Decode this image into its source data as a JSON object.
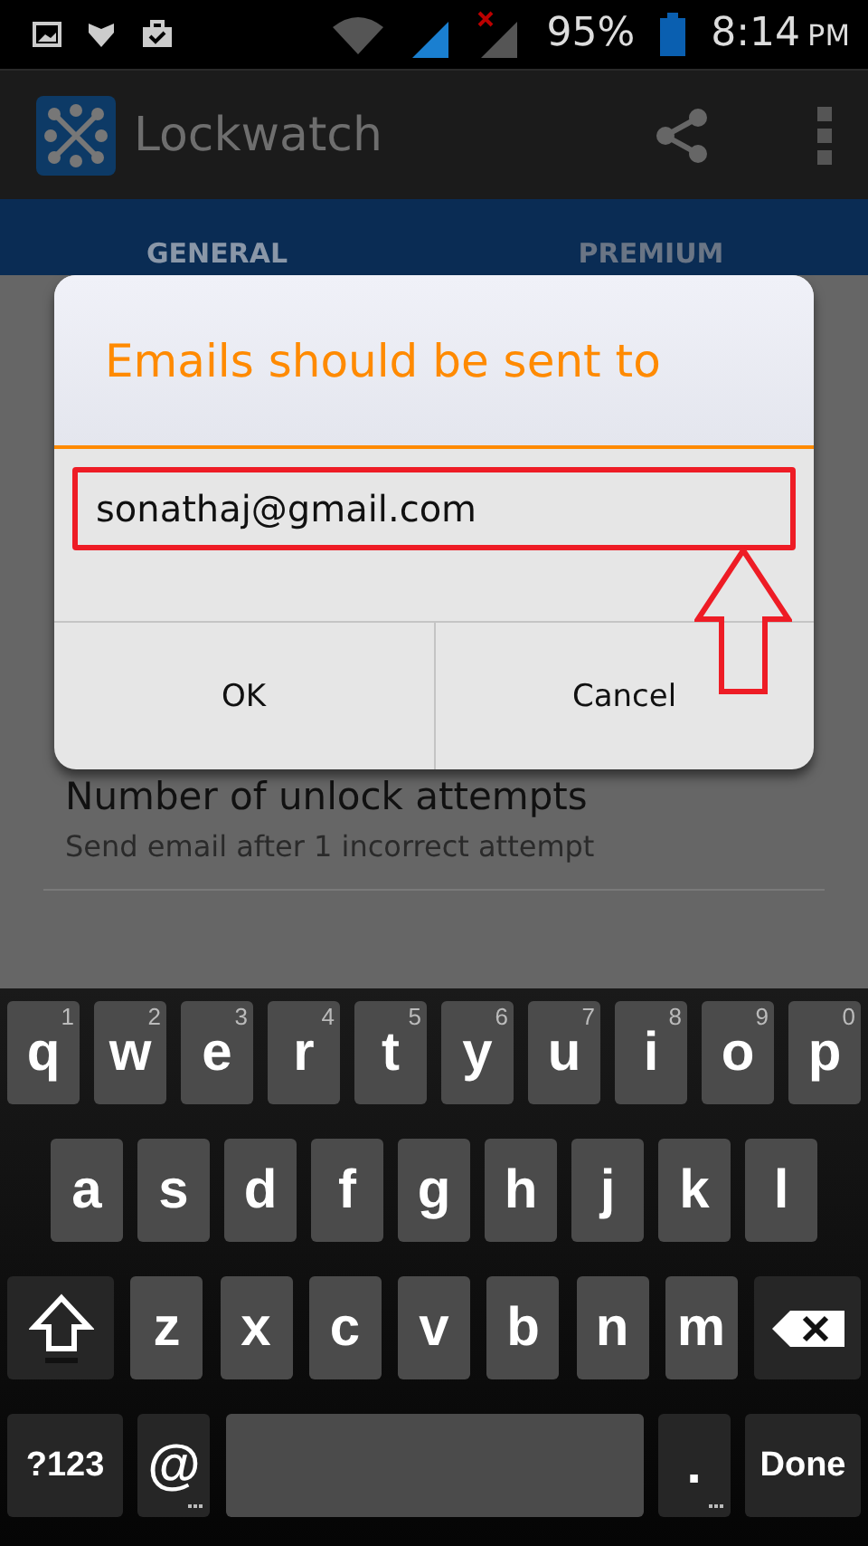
{
  "status_bar": {
    "battery": "95%",
    "time": "8:14",
    "ampm": "PM"
  },
  "app_bar": {
    "title": "Lockwatch"
  },
  "tabs": [
    {
      "label": "GENERAL",
      "selected": true
    },
    {
      "label": "PREMIUM",
      "selected": false
    }
  ],
  "settings": [
    {
      "title": "Number of unlock attempts",
      "summary": "Send email after 1 incorrect attempt"
    }
  ],
  "dialog": {
    "title": "Emails should be sent to",
    "field": {
      "value": "sonathaj@gmail.com"
    },
    "buttons": [
      "OK",
      "Cancel"
    ]
  },
  "keyboard": {
    "row_1": [
      {
        "kind": "letter",
        "label": "q",
        "hint": "1"
      },
      {
        "kind": "letter",
        "label": "w",
        "hint": "2"
      },
      {
        "kind": "letter",
        "label": "e",
        "hint": "3"
      },
      {
        "kind": "letter",
        "label": "r",
        "hint": "4"
      },
      {
        "kind": "letter",
        "label": "t",
        "hint": "5"
      },
      {
        "kind": "letter",
        "label": "y",
        "hint": "6"
      },
      {
        "kind": "letter",
        "label": "u",
        "hint": "7"
      },
      {
        "kind": "letter",
        "label": "i",
        "hint": "8"
      },
      {
        "kind": "letter",
        "label": "o",
        "hint": "9"
      },
      {
        "kind": "letter",
        "label": "p",
        "hint": "0"
      }
    ],
    "row_2": [
      {
        "kind": "letter",
        "label": "a"
      },
      {
        "kind": "letter",
        "label": "s"
      },
      {
        "kind": "letter",
        "label": "d"
      },
      {
        "kind": "letter",
        "label": "f"
      },
      {
        "kind": "letter",
        "label": "g"
      },
      {
        "kind": "letter",
        "label": "h"
      },
      {
        "kind": "letter",
        "label": "j"
      },
      {
        "kind": "letter",
        "label": "k"
      },
      {
        "kind": "letter",
        "label": "l"
      }
    ],
    "row_3": [
      {
        "kind": "shift"
      },
      {
        "kind": "letter",
        "label": "z"
      },
      {
        "kind": "letter",
        "label": "x"
      },
      {
        "kind": "letter",
        "label": "c"
      },
      {
        "kind": "letter",
        "label": "v"
      },
      {
        "kind": "letter",
        "label": "b"
      },
      {
        "kind": "letter",
        "label": "n"
      },
      {
        "kind": "letter",
        "label": "m"
      },
      {
        "kind": "backspace"
      }
    ],
    "row_4": [
      {
        "kind": "symbols",
        "label": "?123"
      },
      {
        "kind": "at",
        "label": "@"
      },
      {
        "kind": "space"
      },
      {
        "kind": "period",
        "label": "."
      },
      {
        "kind": "done",
        "label": "Done"
      }
    ]
  }
}
